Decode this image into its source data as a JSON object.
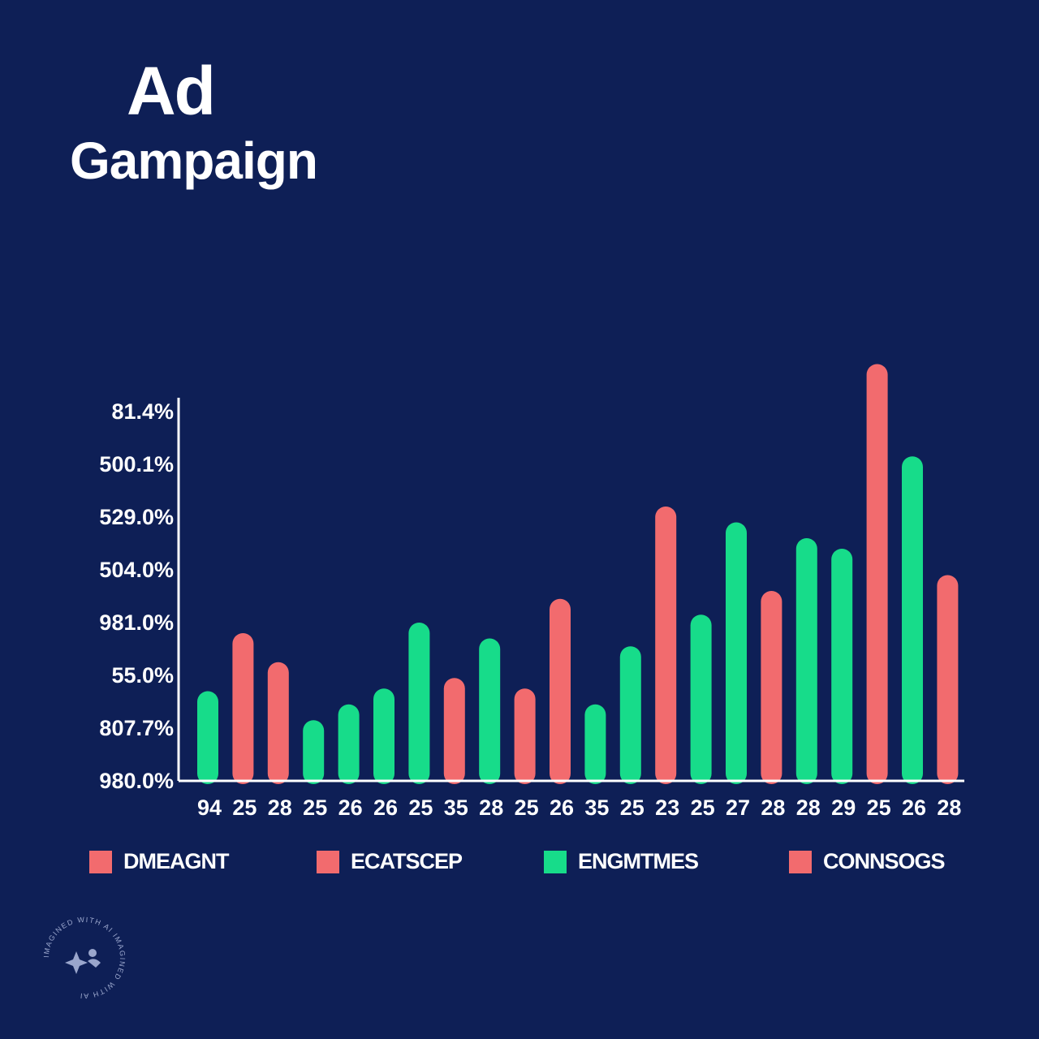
{
  "title": {
    "line1": "Ad",
    "line2": "Gampaign"
  },
  "colors": {
    "background": "#0e1f56",
    "red": "#f26b6e",
    "green": "#17dc8a",
    "axis": "#ffffff"
  },
  "chart_data": {
    "type": "bar",
    "y_tick_labels": [
      "81.4%",
      "500.1%",
      "529.0%",
      "504.0%",
      "981.0%",
      "55.0%",
      "807.7%",
      "980.0%"
    ],
    "categories": [
      "94",
      "25",
      "28",
      "25",
      "26",
      "26",
      "25",
      "35",
      "28",
      "25",
      "26",
      "35",
      "25",
      "23",
      "25",
      "27",
      "28",
      "28",
      "29",
      "25",
      "26",
      "28"
    ],
    "bar_colors": [
      "green",
      "red",
      "red",
      "green",
      "green",
      "green",
      "green",
      "red",
      "green",
      "red",
      "red",
      "green",
      "green",
      "red",
      "green",
      "green",
      "red",
      "green",
      "green",
      "red",
      "green",
      "red"
    ],
    "values": [
      1.7,
      2.8,
      2.25,
      1.15,
      1.45,
      1.75,
      3.0,
      1.95,
      2.7,
      1.75,
      3.45,
      1.45,
      2.55,
      5.2,
      3.15,
      4.9,
      3.6,
      4.6,
      4.4,
      7.9,
      6.15,
      3.9
    ],
    "value_scale": "y-axis tick intervals from the baseline (labels unreadable)",
    "ylim": [
      0,
      7.3
    ],
    "grid": false,
    "legend_position": "bottom"
  },
  "legend": [
    {
      "label": "DMEAGNT",
      "color": "#f26b6e"
    },
    {
      "label": "ECATSCEP",
      "color": "#f26b6e"
    },
    {
      "label": "ENGMTMES",
      "color": "#17dc8a"
    },
    {
      "label": "CONNSOGS",
      "color": "#f26b6e"
    }
  ],
  "watermark": {
    "text": "IMAGINED WITH AI IMAGINED WITH AI",
    "icon": "sparkle-icon"
  }
}
